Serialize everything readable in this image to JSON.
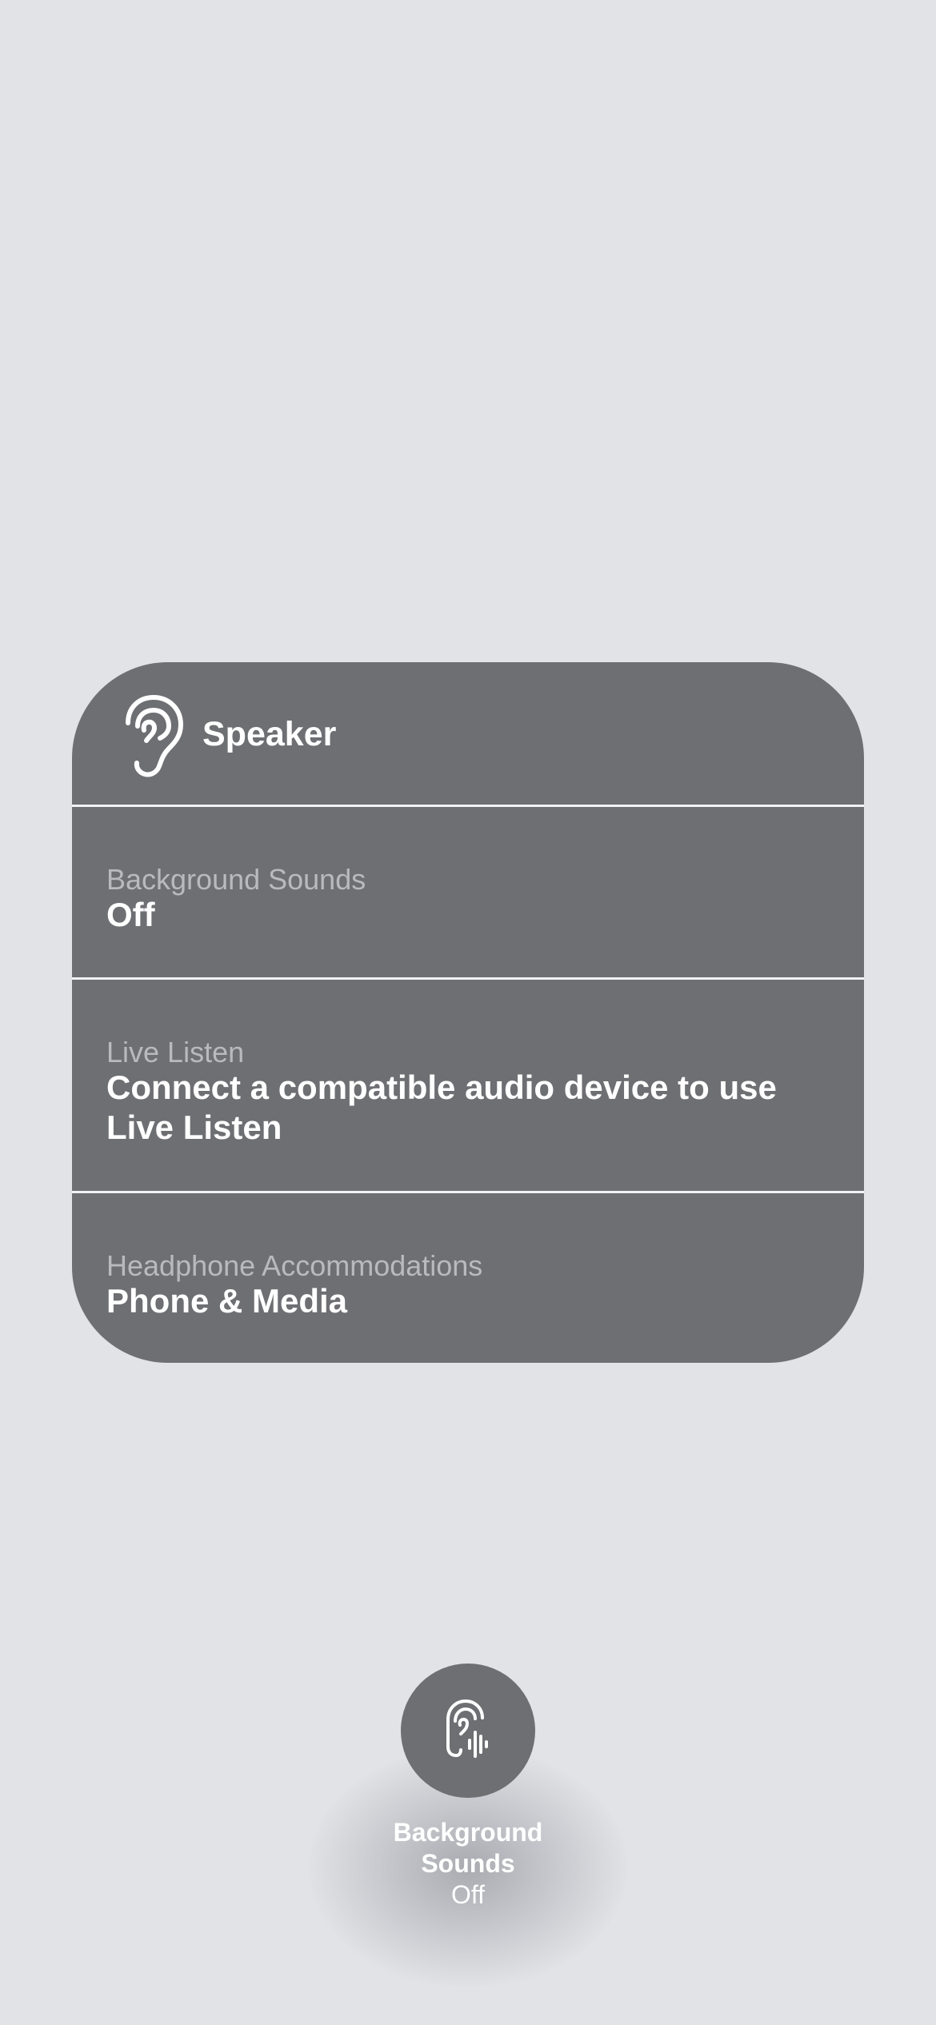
{
  "panel": {
    "title": "Speaker",
    "header_icon": "ear-icon",
    "rows": [
      {
        "label": "Background Sounds",
        "value": "Off"
      },
      {
        "label": "Live Listen",
        "value": "Connect a compatible audio device to use Live Listen"
      },
      {
        "label": "Headphone Accommodations",
        "value": "Phone & Media"
      }
    ]
  },
  "bottom_control": {
    "icon": "ear-with-sound-waves-icon",
    "title": "Background Sounds",
    "status": "Off"
  },
  "colors": {
    "background": "#e2e3e7",
    "panel": "#6e6f73",
    "label": "#b9babe",
    "text": "#ffffff"
  }
}
